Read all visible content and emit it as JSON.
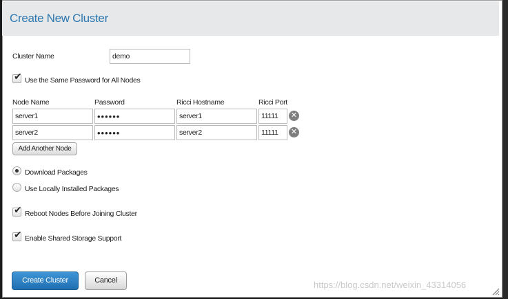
{
  "dialog": {
    "title": "Create New Cluster"
  },
  "cluster_name": {
    "label": "Cluster Name",
    "value": "demo"
  },
  "same_password": {
    "label": "Use the Same Password for All Nodes",
    "checked": true
  },
  "nodes_table": {
    "headers": [
      "Node Name",
      "Password",
      "Ricci Hostname",
      "Ricci Port"
    ],
    "rows": [
      {
        "node_name": "server1",
        "password": "••••••",
        "ricci_hostname": "server1",
        "ricci_port": "11111"
      },
      {
        "node_name": "server2",
        "password": "••••••",
        "ricci_hostname": "server2",
        "ricci_port": "11111"
      }
    ],
    "add_label": "Add Another Node"
  },
  "packages": {
    "download_label": "Download Packages",
    "local_label": "Use Locally Installed Packages",
    "selected": "download"
  },
  "reboot": {
    "label": "Reboot Nodes Before Joining Cluster",
    "checked": true
  },
  "shared_storage": {
    "label": "Enable Shared Storage Support",
    "checked": true
  },
  "buttons": {
    "create": "Create Cluster",
    "cancel": "Cancel"
  },
  "watermark": "https://blog.csdn.net/weixin_43314056",
  "colors": {
    "accent": "#2d78b0",
    "primary_button": "#2a7fc2"
  }
}
